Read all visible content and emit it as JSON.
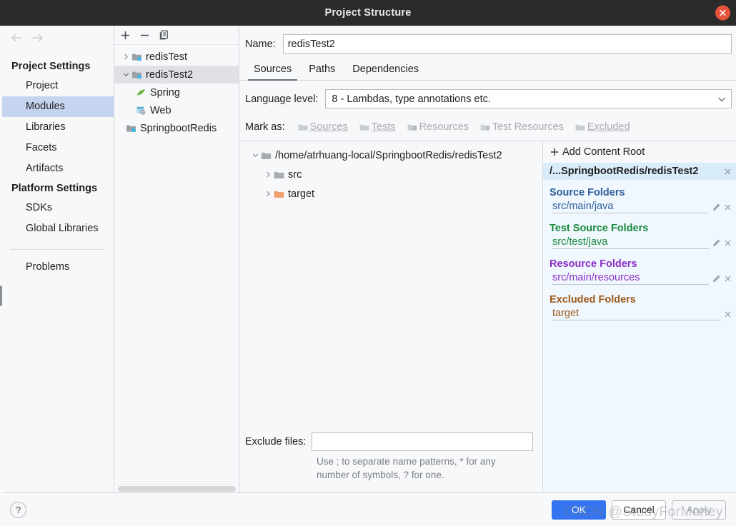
{
  "window": {
    "title": "Project Structure",
    "close_icon": "close-icon"
  },
  "nav": {
    "back_icon": "arrow-left-icon",
    "forward_icon": "arrow-right-icon",
    "groups": [
      {
        "label": "Project Settings",
        "items": [
          {
            "label": "Project",
            "selected": false
          },
          {
            "label": "Modules",
            "selected": true
          },
          {
            "label": "Libraries",
            "selected": false
          },
          {
            "label": "Facets",
            "selected": false
          },
          {
            "label": "Artifacts",
            "selected": false
          }
        ]
      },
      {
        "label": "Platform Settings",
        "items": [
          {
            "label": "SDKs",
            "selected": false
          },
          {
            "label": "Global Libraries",
            "selected": false
          }
        ]
      }
    ],
    "problems": "Problems"
  },
  "modules": {
    "toolbar": {
      "add": "plus-icon",
      "remove": "minus-icon",
      "copy": "copy-icon"
    },
    "tree": [
      {
        "label": "redisTest",
        "icon": "module-icon",
        "twisty": "collapsed",
        "indent": 0,
        "selected": false
      },
      {
        "label": "redisTest2",
        "icon": "module-icon",
        "twisty": "expanded",
        "indent": 0,
        "selected": true
      },
      {
        "label": "Spring",
        "icon": "spring-leaf-icon",
        "twisty": "none",
        "indent": 2,
        "selected": false
      },
      {
        "label": "Web",
        "icon": "web-facet-icon",
        "twisty": "none",
        "indent": 2,
        "selected": false
      },
      {
        "label": "SpringbootRedis",
        "icon": "module-icon",
        "twisty": "none",
        "indent": 1,
        "selected": false
      }
    ]
  },
  "main": {
    "name_label": "Name:",
    "name_value": "redisTest2",
    "tabs": [
      {
        "label": "Sources",
        "active": true
      },
      {
        "label": "Paths",
        "active": false
      },
      {
        "label": "Dependencies",
        "active": false
      }
    ],
    "language_level_label": "Language level:",
    "language_level_value": "8 - Lambdas, type annotations etc.",
    "mark_as_label": "Mark as:",
    "mark_as_buttons": [
      {
        "label": "Sources",
        "mnemonic": "S",
        "icon": "folder-sources-icon"
      },
      {
        "label": "Tests",
        "mnemonic": "T",
        "icon": "folder-tests-icon"
      },
      {
        "label": "Resources",
        "mnemonic": "",
        "icon": "folder-resources-icon"
      },
      {
        "label": "Test Resources",
        "mnemonic": "",
        "icon": "folder-test-resources-icon"
      },
      {
        "label": "Excluded",
        "mnemonic": "E",
        "icon": "folder-excluded-icon"
      }
    ],
    "content_tree": [
      {
        "label": "/home/atrhuang-local/SpringbootRedis/redisTest2",
        "twisty": "expanded",
        "level": 0,
        "folder": "gray"
      },
      {
        "label": "src",
        "twisty": "collapsed",
        "level": 1,
        "folder": "gray"
      },
      {
        "label": "target",
        "twisty": "collapsed",
        "level": 1,
        "folder": "orange"
      }
    ],
    "exclude_files_label": "Exclude files:",
    "exclude_files_value": "",
    "exclude_hint": "Use ; to separate name patterns, * for any number of symbols, ? for one."
  },
  "detail": {
    "add_content_root": "Add Content Root",
    "add_content_root_mnemonic": "C",
    "add_icon": "plus-icon",
    "root_path": "/...SpringbootRedis/redisTest2",
    "groups": [
      {
        "title": "Source Folders",
        "color": "#2b5f9e",
        "entries": [
          {
            "path": "src/main/java",
            "has_edit": true,
            "has_remove": true
          }
        ]
      },
      {
        "title": "Test Source Folders",
        "color": "#1a8a3e",
        "entries": [
          {
            "path": "src/test/java",
            "has_edit": true,
            "has_remove": true
          }
        ]
      },
      {
        "title": "Resource Folders",
        "color": "#8b2fc9",
        "entries": [
          {
            "path": "src/main/resources",
            "has_edit": true,
            "has_remove": true
          }
        ]
      },
      {
        "title": "Excluded Folders",
        "color": "#9c5a1a",
        "entries": [
          {
            "path": "target",
            "has_edit": false,
            "has_remove": true
          }
        ]
      }
    ]
  },
  "footer": {
    "help_label": "?",
    "ok": "OK",
    "cancel": "Cancel",
    "apply": "Apply",
    "watermark": "CSDN @StudyForMoney"
  },
  "colors": {
    "accent": "#3574f0",
    "selection": "#c5d5f0",
    "tree_selection": "#dfe1e5",
    "detail_bg": "#f0f7fd",
    "root_header_bg": "#d9ecfa",
    "titlebar": "#2b2b2b",
    "close": "#e8543b"
  }
}
